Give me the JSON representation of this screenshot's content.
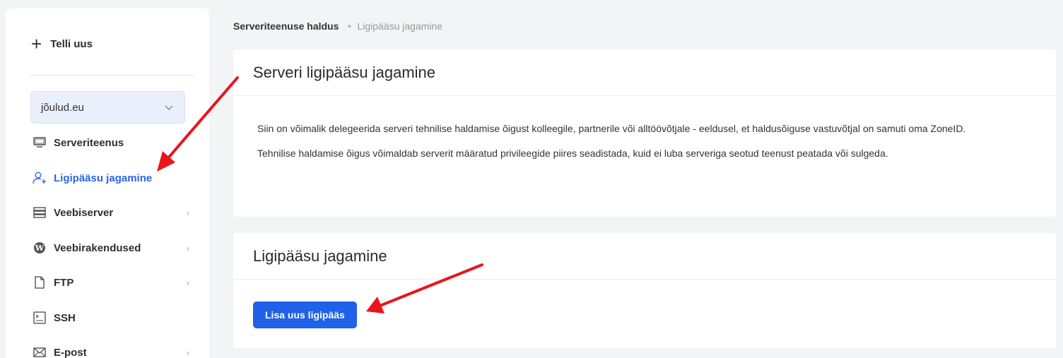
{
  "sidebar": {
    "new_order_label": "Telli uus",
    "domain_select": {
      "value": "jõulud.eu"
    },
    "items": [
      {
        "label": "Serveriteenus",
        "icon": "monitor-icon"
      },
      {
        "label": "Ligipääsu jagamine",
        "icon": "user-add-icon",
        "active": true
      },
      {
        "label": "Veebiserver",
        "icon": "server-icon"
      },
      {
        "label": "Veebirakendused",
        "icon": "wordpress-icon"
      },
      {
        "label": "FTP",
        "icon": "file-icon"
      },
      {
        "label": "SSH",
        "icon": "terminal-icon"
      },
      {
        "label": "E-post",
        "icon": "mail-icon"
      }
    ]
  },
  "breadcrumb": {
    "items": [
      "Serveriteenuse haldus",
      "Ligipääsu jagamine"
    ]
  },
  "info_card": {
    "title": "Serveri ligipääsu jagamine",
    "paragraphs": [
      "Siin on võimalik delegeerida serveri tehnilise haldamise õigust kolleegile, partnerile või alltöövõtjale - eeldusel, et haldusõiguse vastuvõtjal on samuti oma ZoneID.",
      "Tehnilise haldamise õigus võimaldab serverit määratud privileegide piires seadistada, kuid ei luba serveriga seotud teenust peatada või sulgeda."
    ]
  },
  "access_card": {
    "title": "Ligipääsu jagamine",
    "add_button_label": "Lisa uus ligipääs"
  },
  "colors": {
    "accent": "#1f61e8",
    "active_nav": "#2b66e8",
    "annotation_arrow": "#e8151b"
  }
}
